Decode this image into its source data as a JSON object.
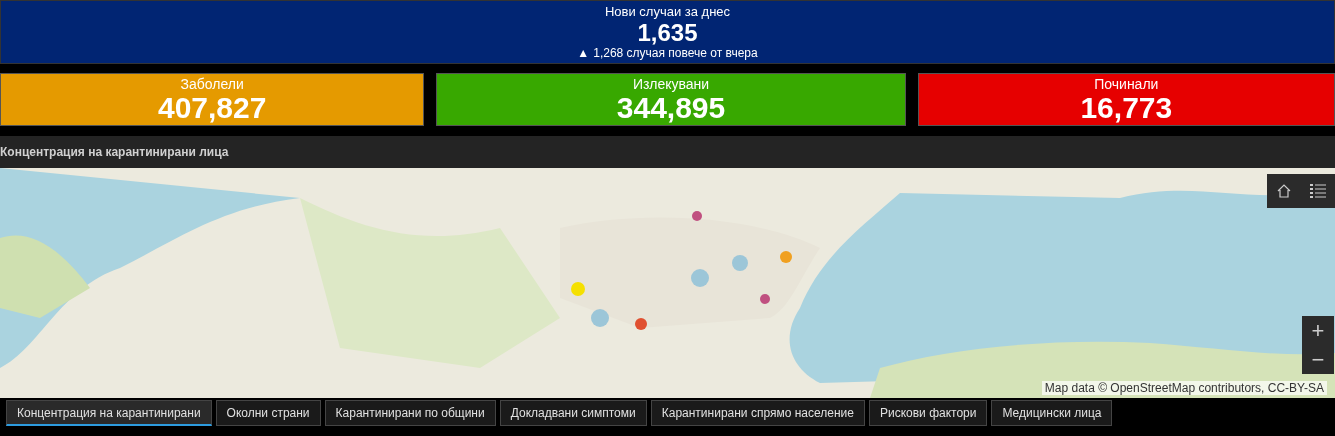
{
  "header": {
    "title": "Нови случаи за днес",
    "value": "1,635",
    "change_arrow": "▲",
    "change_text": "1,268 случая повече от вчера"
  },
  "indicators": [
    {
      "label": "Заболели",
      "value": "407,827",
      "color": "#e59a00"
    },
    {
      "label": "Излекувани",
      "value": "344,895",
      "color": "#38a800"
    },
    {
      "label": "Починали",
      "value": "16,773",
      "color": "#e60000"
    }
  ],
  "map_panel": {
    "title": "Концентрация на карантинирани лица",
    "zoom_in": "+",
    "zoom_out": "−",
    "attribution": "Map data © OpenStreetMap contributors, CC-BY-SA"
  },
  "tabs": [
    {
      "label": "Концентрация на карантинирани",
      "selected": true
    },
    {
      "label": "Околни страни",
      "selected": false
    },
    {
      "label": "Карантинирани по общини",
      "selected": false
    },
    {
      "label": "Докладвани симптоми",
      "selected": false
    },
    {
      "label": "Карантинирани спрямо население",
      "selected": false
    },
    {
      "label": "Рискови фактори",
      "selected": false
    },
    {
      "label": "Медицински лица",
      "selected": false
    }
  ]
}
